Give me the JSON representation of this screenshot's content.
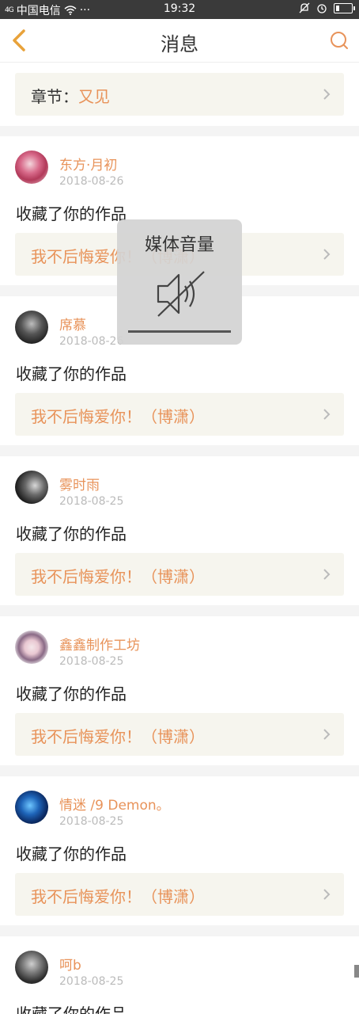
{
  "status_bar": {
    "signal": "4G",
    "carrier": "中国电信",
    "more": "···",
    "time": "19:32"
  },
  "header": {
    "title": "消息"
  },
  "chapter": {
    "label": "章节：",
    "value": "又见"
  },
  "volume_overlay": {
    "title": "媒体音量",
    "level": 0
  },
  "messages": [
    {
      "user": "东方·月初",
      "date": "2018-08-26",
      "action": "收藏了你的作品",
      "work": "我不后悔爱你！（博潇）"
    },
    {
      "user": "席慕",
      "date": "2018-08-26",
      "action": "收藏了你的作品",
      "work": "我不后悔爱你！（博潇）"
    },
    {
      "user": "雾时雨",
      "date": "2018-08-25",
      "action": "收藏了你的作品",
      "work": "我不后悔爱你！（博潇）"
    },
    {
      "user": "鑫鑫制作工坊",
      "date": "2018-08-25",
      "action": "收藏了你的作品",
      "work": "我不后悔爱你！（博潇）"
    },
    {
      "user": "情迷 /9 Demon。",
      "date": "2018-08-25",
      "action": "收藏了你的作品",
      "work": "我不后悔爱你！（博潇）"
    },
    {
      "user": "呵b",
      "date": "2018-08-25",
      "action": "收藏了你的作品",
      "work": ""
    }
  ],
  "colors": {
    "accent": "#e8935a",
    "link_bg": "#f6f5ee",
    "page_bg": "#f4f4f4"
  }
}
